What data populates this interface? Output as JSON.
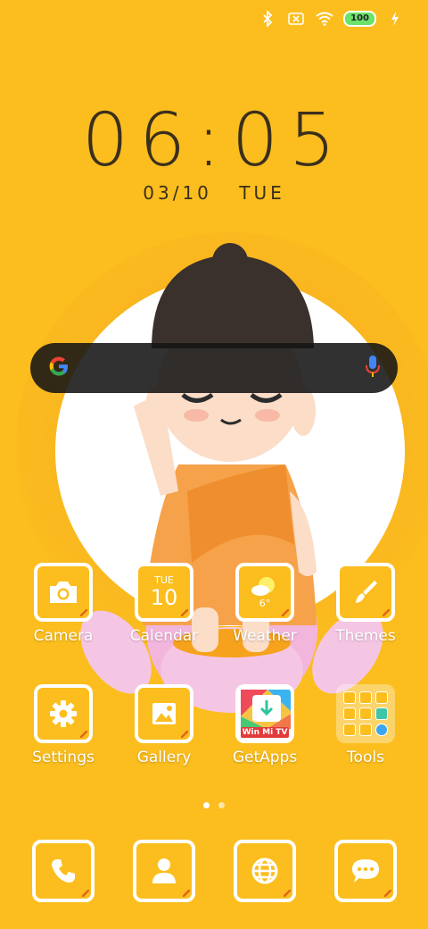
{
  "status_bar": {
    "battery": "100",
    "icons": [
      "bluetooth-icon",
      "no-sim-icon",
      "wifi-icon",
      "battery-icon",
      "charging-icon"
    ]
  },
  "clock": {
    "time": "06:05",
    "date": "03/10",
    "day": "TUE"
  },
  "search": {
    "icons": [
      "google-logo-icon",
      "mic-icon"
    ]
  },
  "apps": [
    {
      "label": "Camera",
      "icon": "camera-icon"
    },
    {
      "label": "Calendar",
      "icon": "calendar-icon",
      "day": "TUE",
      "date": "10"
    },
    {
      "label": "Weather",
      "icon": "weather-icon",
      "temp": "6°"
    },
    {
      "label": "Themes",
      "icon": "brush-icon"
    },
    {
      "label": "Settings",
      "icon": "gear-icon"
    },
    {
      "label": "Gallery",
      "icon": "image-icon"
    },
    {
      "label": "GetApps",
      "icon": "getapps-icon",
      "banner": "Win Mi TV"
    },
    {
      "label": "Tools",
      "icon": "folder-icon"
    }
  ],
  "dock": [
    {
      "icon": "phone-icon"
    },
    {
      "icon": "contacts-icon"
    },
    {
      "icon": "browser-icon"
    },
    {
      "icon": "messages-icon"
    }
  ],
  "colors": {
    "background": "#FBBE1E",
    "tile_border": "#FFFFFF"
  },
  "pager": {
    "pages": 2,
    "current": 1
  }
}
